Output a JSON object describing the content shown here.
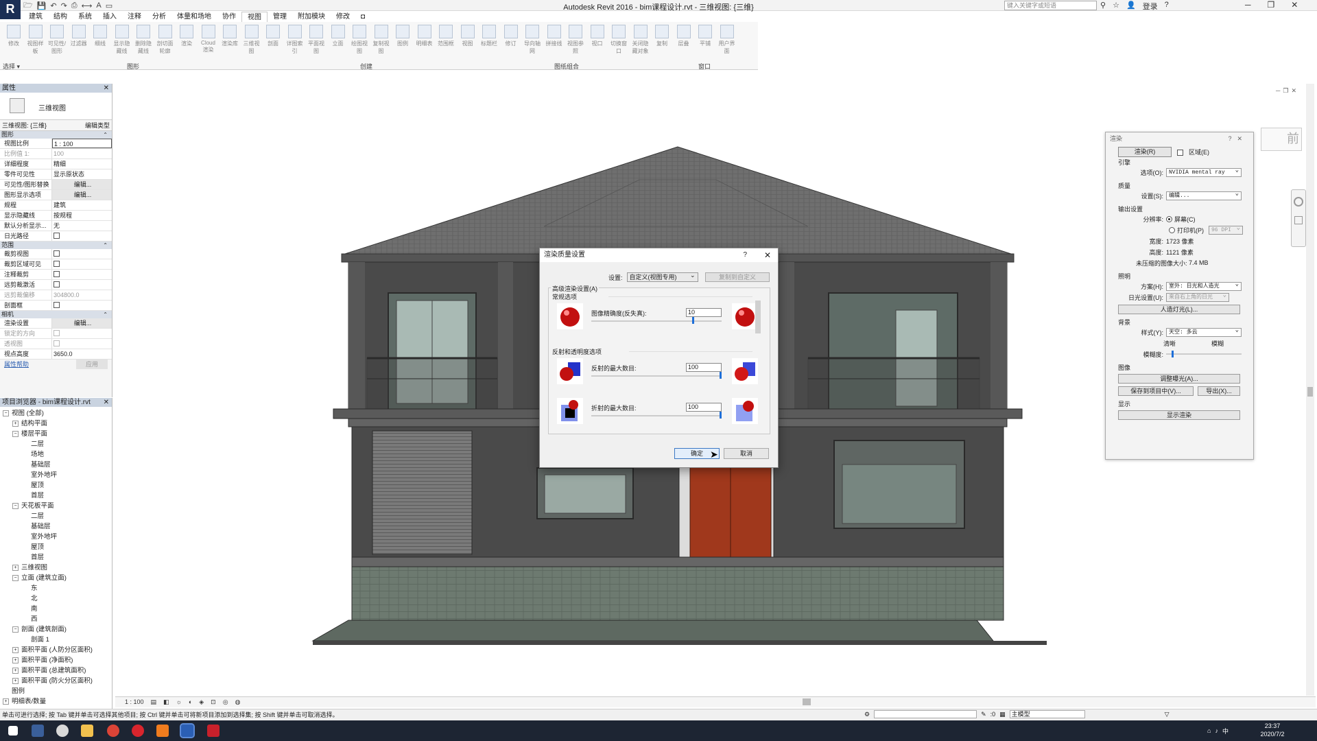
{
  "window": {
    "logo": "R",
    "title": "Autodesk Revit 2016 -   bim课程设计.rvt - 三维视图: {三维}",
    "search_placeholder": "键入关键字或短语",
    "signin": "登录",
    "qat_icons": [
      "open-icon",
      "save-icon",
      "undo-icon",
      "redo-icon",
      "print-icon",
      "measure-icon",
      "text-icon",
      "switch-window-icon"
    ]
  },
  "ribbon": {
    "tabs": [
      "建筑",
      "结构",
      "系统",
      "插入",
      "注释",
      "分析",
      "体量和场地",
      "协作",
      "视图",
      "管理",
      "附加模块",
      "修改",
      "◘"
    ],
    "active_tab": "视图",
    "buttons": [
      "修改",
      "视图样板",
      "可见性/图形",
      "过滤器",
      "细线",
      "显示隐藏线",
      "删除隐藏线",
      "剖切面轮廓",
      "渲染",
      "Cloud 渲染",
      "渲染库",
      "三维视图",
      "剖面",
      "详图索引",
      "平面视图",
      "立面",
      "绘图视图",
      "复制视图",
      "图例",
      "明细表",
      "范围框",
      "视图",
      "标题栏",
      "修订",
      "导向轴网",
      "拼接线",
      "视图参照",
      "视口",
      "切换窗口",
      "关闭隐藏对象",
      "复制",
      "层叠",
      "平铺",
      "用户界面"
    ],
    "groups": [
      {
        "id": "select",
        "label": "选择 ▾"
      },
      {
        "id": "graphics",
        "label": "图形"
      },
      {
        "id": "create",
        "label": "创建"
      },
      {
        "id": "sheet",
        "label": "图纸组合"
      },
      {
        "id": "windows",
        "label": "窗口"
      }
    ]
  },
  "properties": {
    "title": "属性",
    "type_name": "三维视图",
    "instance": "三维视图: {三维}",
    "edit_type": "编辑类型",
    "sections": [
      {
        "name": "图形",
        "rows": [
          {
            "k": "视图比例",
            "v": "1 : 100"
          },
          {
            "k": "比例值 1:",
            "v": "100",
            "dim": true
          },
          {
            "k": "详细程度",
            "v": "精细"
          },
          {
            "k": "零件可见性",
            "v": "显示原状态"
          },
          {
            "k": "可见性/图形替换",
            "v": "编辑...",
            "btn": true
          },
          {
            "k": "图形显示选项",
            "v": "编辑...",
            "btn": true
          },
          {
            "k": "规程",
            "v": "建筑"
          },
          {
            "k": "显示隐藏线",
            "v": "按规程"
          },
          {
            "k": "默认分析显示...",
            "v": "无"
          },
          {
            "k": "日光路径",
            "v": "",
            "chk": true
          }
        ]
      },
      {
        "name": "范围",
        "rows": [
          {
            "k": "裁剪视图",
            "v": "",
            "chk": true
          },
          {
            "k": "裁剪区域可见",
            "v": "",
            "chk": true
          },
          {
            "k": "注释裁剪",
            "v": "",
            "chk": true
          },
          {
            "k": "远剪裁激活",
            "v": "",
            "chk": true
          },
          {
            "k": "远剪裁偏移",
            "v": "304800.0",
            "dim": true
          },
          {
            "k": "剖面框",
            "v": "",
            "chk": true
          }
        ]
      },
      {
        "name": "相机",
        "rows": [
          {
            "k": "渲染设置",
            "v": "编辑...",
            "btn": true
          },
          {
            "k": "锁定的方向",
            "v": "",
            "dim": true,
            "chk": true
          },
          {
            "k": "透视图",
            "v": "",
            "dim": true,
            "chk": true
          },
          {
            "k": "视点高度",
            "v": "3650.0"
          }
        ]
      }
    ],
    "help_link": "属性帮助",
    "apply": "应用"
  },
  "browser": {
    "title": "项目浏览器 - bim课程设计.rvt",
    "items": [
      {
        "label": "视图 (全部)",
        "depth": 0,
        "tg": "⊟",
        "icon": true
      },
      {
        "label": "结构平面",
        "depth": 1,
        "tg": "⊞"
      },
      {
        "label": "楼层平面",
        "depth": 1,
        "tg": "⊟"
      },
      {
        "label": "二层",
        "depth": 2
      },
      {
        "label": "场地",
        "depth": 2
      },
      {
        "label": "基础层",
        "depth": 2
      },
      {
        "label": "室外地坪",
        "depth": 2
      },
      {
        "label": "屋顶",
        "depth": 2
      },
      {
        "label": "首层",
        "depth": 2
      },
      {
        "label": "天花板平面",
        "depth": 1,
        "tg": "⊟"
      },
      {
        "label": "二层",
        "depth": 2
      },
      {
        "label": "基础层",
        "depth": 2
      },
      {
        "label": "室外地坪",
        "depth": 2
      },
      {
        "label": "屋顶",
        "depth": 2
      },
      {
        "label": "首层",
        "depth": 2
      },
      {
        "label": "三维视图",
        "depth": 1,
        "tg": "⊞"
      },
      {
        "label": "立面 (建筑立面)",
        "depth": 1,
        "tg": "⊟"
      },
      {
        "label": "东",
        "depth": 2
      },
      {
        "label": "北",
        "depth": 2
      },
      {
        "label": "南",
        "depth": 2
      },
      {
        "label": "西",
        "depth": 2
      },
      {
        "label": "剖面 (建筑剖面)",
        "depth": 1,
        "tg": "⊟"
      },
      {
        "label": "剖面 1",
        "depth": 2
      },
      {
        "label": "面积平面 (人防分区面积)",
        "depth": 1,
        "tg": "⊞"
      },
      {
        "label": "面积平面 (净面积)",
        "depth": 1,
        "tg": "⊞"
      },
      {
        "label": "面积平面 (总建筑面积)",
        "depth": 1,
        "tg": "⊞"
      },
      {
        "label": "面积平面 (防火分区面积)",
        "depth": 1,
        "tg": "⊞"
      },
      {
        "label": "图例",
        "depth": 0,
        "tg": " ",
        "icon": true
      },
      {
        "label": "明细表/数量",
        "depth": 0,
        "tg": "⊞",
        "icon": true
      }
    ]
  },
  "render_panel": {
    "title": "渲染",
    "render_btn": "渲染(R)",
    "region_label": "区域(E)",
    "engine_section": "引擎",
    "engine_label": "选项(O):",
    "engine_value": "NVIDIA mental ray",
    "quality_section": "质量",
    "quality_label": "设置(S):",
    "quality_value": "编辑...",
    "output_section": "输出设置",
    "resolution_label": "分辨率:",
    "screen_label": "屏幕(C)",
    "printer_label": "打印机(P)",
    "dpi_value": "96 DPI",
    "width_label": "宽度:",
    "width_value": "1723 像素",
    "height_label": "高度:",
    "height_value": "1121 像素",
    "size_label": "未压缩的图像大小:",
    "size_value": "7.4 MB",
    "lighting_section": "照明",
    "scheme_label": "方案(H):",
    "scheme_value": "室外: 日光和人造光",
    "sun_label": "日光设置(U):",
    "sun_value": "来自右上角的日光",
    "artificial_btn": "人造灯光(L)...",
    "background_section": "背景",
    "style_label": "样式(Y):",
    "style_value": "天空: 多云",
    "clear_label": "清晰",
    "hazy_label": "模糊",
    "haze_label": "模糊度:",
    "haze_level": 0.1,
    "image_section": "图像",
    "exposure_btn": "调整曝光(A)...",
    "save_btn": "保存到项目中(V)...",
    "export_btn": "导出(X)...",
    "display_section": "显示",
    "show_btn": "显示渲染"
  },
  "dialog": {
    "title": "渲染质量设置",
    "help": "?",
    "setting_label": "设置:",
    "setting_value": "自定义(视图专用)",
    "copy_btn": "复制到自定义",
    "adv_legend": "高级渲染设置(A)",
    "general_label": "常规选项",
    "image_precision_label": "图像精确度(反失真):",
    "image_precision_value": "10",
    "image_precision_level": 0.79,
    "reflect_group": "反射和透明度选项",
    "max_reflect_label": "反射的最大数目:",
    "max_reflect_value": "100",
    "max_reflect_level": 1.0,
    "max_refract_label": "折射的最大数目:",
    "max_refract_value": "100",
    "max_refract_level": 1.0,
    "ok": "确定",
    "cancel": "取消"
  },
  "viewbar": {
    "scale": "1 : 100"
  },
  "viewcube": {
    "face": "前"
  },
  "status": {
    "message": "单击可进行选择; 按 Tab 键并单击可选择其他项目; 按 Ctrl 键并单击可将新项目添加到选择集; 按 Shift 键并单击可取消选择。",
    "coord": ":0",
    "model_label": "主模型"
  },
  "taskbar": {
    "time": "23:37",
    "date": "2020/7/2",
    "ime": "中"
  },
  "colors": {
    "roof": "#6e6e6e",
    "wall": "#4b4b4b",
    "door": "#a0381c",
    "ribbon_bg": "#f7f7f7",
    "accent": "#1e6fd9"
  }
}
